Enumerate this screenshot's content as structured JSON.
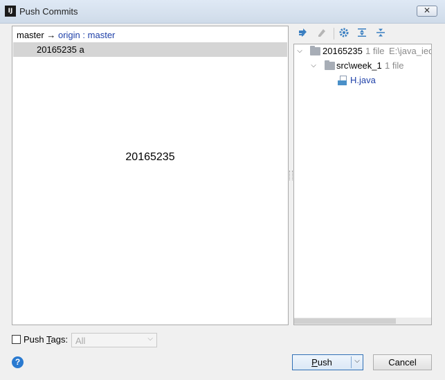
{
  "window": {
    "title": "Push Commits",
    "app_icon_text": "IJ",
    "close_glyph": "✕"
  },
  "commits": {
    "branch_local": "master",
    "arrow": "→",
    "remote": "origin",
    "separator": ":",
    "branch_remote": "master",
    "rows": [
      {
        "label": "20165235 a"
      }
    ],
    "detail_text": "20165235"
  },
  "toolbar": {
    "icons": [
      "expand-diff-icon",
      "edit-source-icon",
      "settings-icon",
      "expand-all-icon",
      "collapse-all-icon"
    ]
  },
  "tree": {
    "root": {
      "name": "20165235",
      "count": "1 file",
      "path": "E:\\java_ied"
    },
    "folder": {
      "name": "src\\week_1",
      "count": "1 file"
    },
    "file": {
      "name": "H.java"
    }
  },
  "bottom": {
    "push_tags_prefix": "Push ",
    "push_tags_mnemonic": "T",
    "push_tags_suffix": "ags:",
    "tags_value": "All",
    "help_glyph": "?",
    "push_mnemonic": "P",
    "push_rest": "ush",
    "cancel_label": "Cancel"
  },
  "colors": {
    "accent": "#2a7ad0",
    "link": "#1d3fa8",
    "selection": "#d5d5d5"
  }
}
